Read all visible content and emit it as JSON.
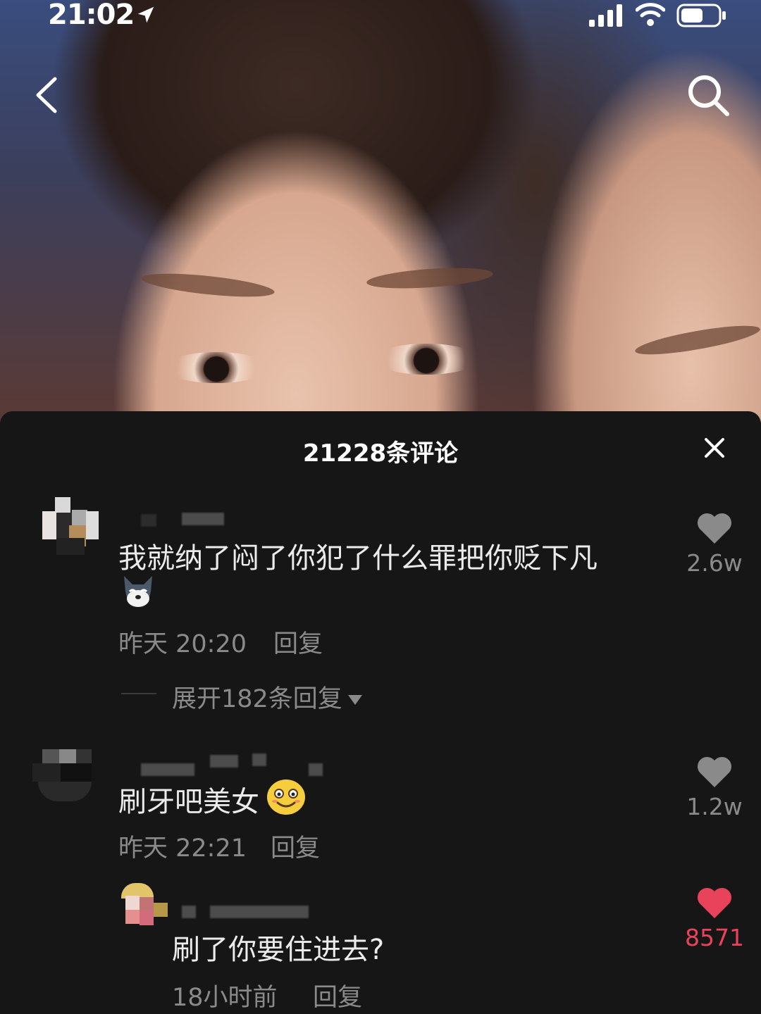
{
  "status_bar": {
    "time": "21:02"
  },
  "panel": {
    "title": "21228条评论"
  },
  "comments": [
    {
      "text": "我就纳了闷了你犯了什么罪把你贬下凡",
      "emoji": "wolf-emoji",
      "time": "昨天 20:20",
      "reply_label": "回复",
      "likes": "2.6w",
      "expand_label": "展开182条回复"
    },
    {
      "text": "刷牙吧美女",
      "emoji": "smile-emoji",
      "time": "昨天 22:21",
      "reply_label": "回复",
      "likes": "1.2w"
    },
    {
      "text": "刷了你要住进去?",
      "time": "18小时前",
      "reply_label": "回复",
      "likes": "8571",
      "liked": true
    }
  ],
  "colors": {
    "panel_bg": "#161616",
    "like_active": "#e8435a",
    "muted_text": "#8a8a8a"
  }
}
